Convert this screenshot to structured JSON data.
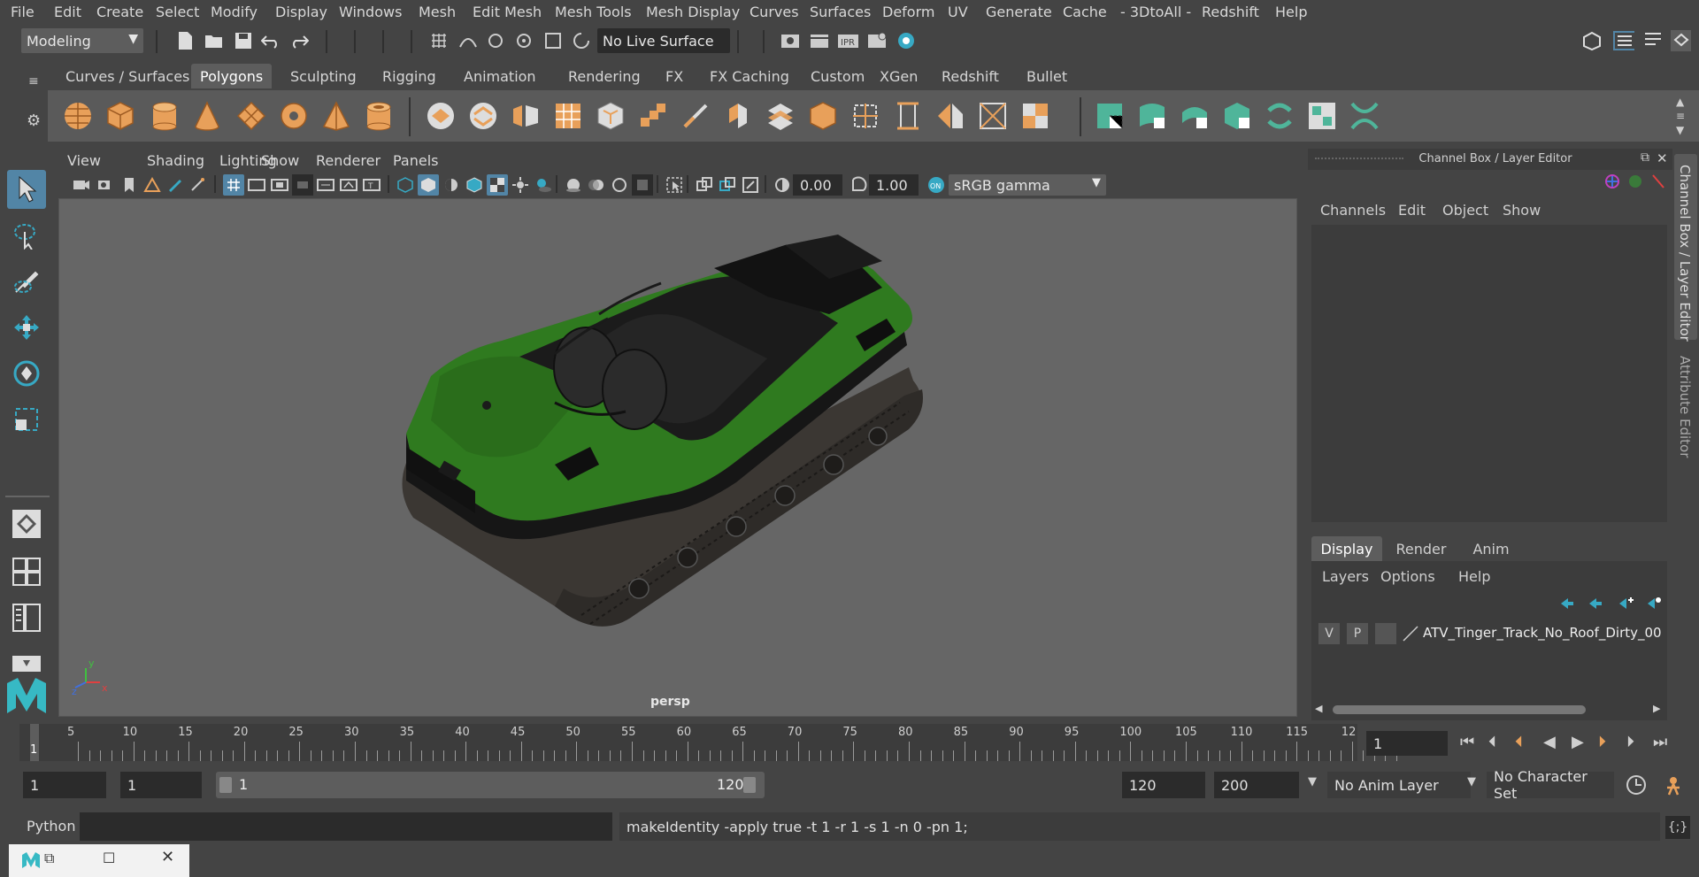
{
  "menubar": {
    "items": [
      "File",
      "Edit",
      "Create",
      "Select",
      "Modify",
      "Display",
      "Windows",
      "Mesh",
      "Edit Mesh",
      "Mesh Tools",
      "Mesh Display",
      "Curves",
      "Surfaces",
      "Deform",
      "UV",
      "Generate",
      "Cache",
      "- 3DtoAll -",
      "Redshift",
      "Help"
    ]
  },
  "statusline": {
    "mode": "Modeling",
    "live_surface": "No Live Surface"
  },
  "shelf": {
    "tabs": [
      "Curves / Surfaces",
      "Polygons",
      "Sculpting",
      "Rigging",
      "Animation",
      "Rendering",
      "FX",
      "FX Caching",
      "Custom",
      "XGen",
      "Redshift",
      "Bullet"
    ],
    "active_tab": "Polygons"
  },
  "viewport": {
    "menu": [
      "View",
      "Shading",
      "Lighting",
      "Show",
      "Renderer",
      "Panels"
    ],
    "exposure": "0.00",
    "gamma": "1.00",
    "color_space": "sRGB gamma",
    "camera_label": "persp",
    "axis_labels": {
      "x": "x",
      "y": "y",
      "z": "z"
    }
  },
  "channel_box": {
    "title": "Channel Box / Layer Editor",
    "menu": [
      "Channels",
      "Edit",
      "Object",
      "Show"
    ]
  },
  "layer_editor": {
    "tabs": [
      "Display",
      "Render",
      "Anim"
    ],
    "active_tab": "Display",
    "menu": [
      "Layers",
      "Options",
      "Help"
    ],
    "layer": {
      "v": "V",
      "p": "P",
      "name": "ATV_Tinger_Track_No_Roof_Dirty_00"
    }
  },
  "side_tabs": [
    "Channel Box / Layer Editor",
    "Attribute Editor"
  ],
  "timeline": {
    "ticks": [
      "5",
      "10",
      "15",
      "20",
      "25",
      "30",
      "35",
      "40",
      "45",
      "50",
      "55",
      "60",
      "65",
      "70",
      "75",
      "80",
      "85",
      "90",
      "95",
      "100",
      "105",
      "110",
      "115",
      "12"
    ],
    "start_marker": "1",
    "current_frame": "1"
  },
  "range": {
    "start": "1",
    "playback_start": "1",
    "slider_start": "1",
    "slider_end": "120",
    "playback_end": "120",
    "end": "200",
    "anim_layer": "No Anim Layer",
    "character_set": "No Character Set"
  },
  "cmdline": {
    "lang": "Python",
    "output": "makeIdentity -apply true -t 1 -r 1 -s 1 -n 0 -pn 1;"
  },
  "colors": {
    "accent": "#5285a6",
    "shelf_orange": "#e8a05a",
    "shelf_teal": "#4fb59a",
    "model_green": "#2f7a1f"
  }
}
